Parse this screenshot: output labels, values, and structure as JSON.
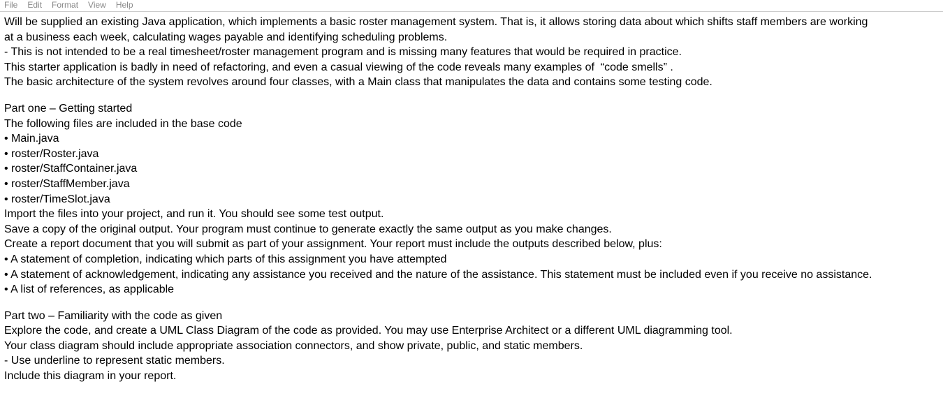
{
  "menubar": {
    "file": "File",
    "edit": "Edit",
    "format": "Format",
    "view": "View",
    "help": "Help"
  },
  "doc": {
    "intro": {
      "p1a": "Will be supplied an existing Java application, which implements a basic roster management system. That is, it allows storing data about which shifts staff members are working",
      "p1b": "at a business each week, calculating wages payable and identifying scheduling problems.",
      "p2": "- This is not intended to be a real timesheet/roster management program and is missing many features that would be required in practice.",
      "p3": "This starter application is badly in need of refactoring, and even a casual viewing of the code reveals many examples of  “code smells” .",
      "p4": "The basic architecture of the system revolves around four classes, with a Main class that manipulates the data and contains some testing code."
    },
    "part1": {
      "title": "Part one – Getting started",
      "line1": "The following files are included in the base code",
      "file1": "• Main.java",
      "file2": "• roster/Roster.java",
      "file3": "• roster/StaffContainer.java",
      "file4": "• roster/StaffMember.java",
      "file5": "• roster/TimeSlot.java",
      "instr1": "Import the files into your project, and run it. You should see some test output.",
      "instr2": "Save a copy of the original output. Your program must continue to generate exactly the same output as you make changes.",
      "instr3": "Create a report document that you will submit as part of your assignment. Your report must include the outputs described below, plus:",
      "req1": "• A statement of completion, indicating which parts of this assignment you have attempted",
      "req2": "• A statement of acknowledgement, indicating any assistance you received and the nature of the assistance. This statement must be included even if you receive no assistance.",
      "req3": "• A list of references, as applicable"
    },
    "part2": {
      "title": "Part two – Familiarity with the code as given",
      "line1": "Explore the code, and create a UML Class Diagram of the code as provided. You may use Enterprise Architect or a different UML diagramming tool.",
      "line2": "Your class diagram should include appropriate association connectors, and show private, public, and static members.",
      "line3": "- Use underline to represent static members.",
      "line4": "Include this diagram in your report."
    }
  }
}
